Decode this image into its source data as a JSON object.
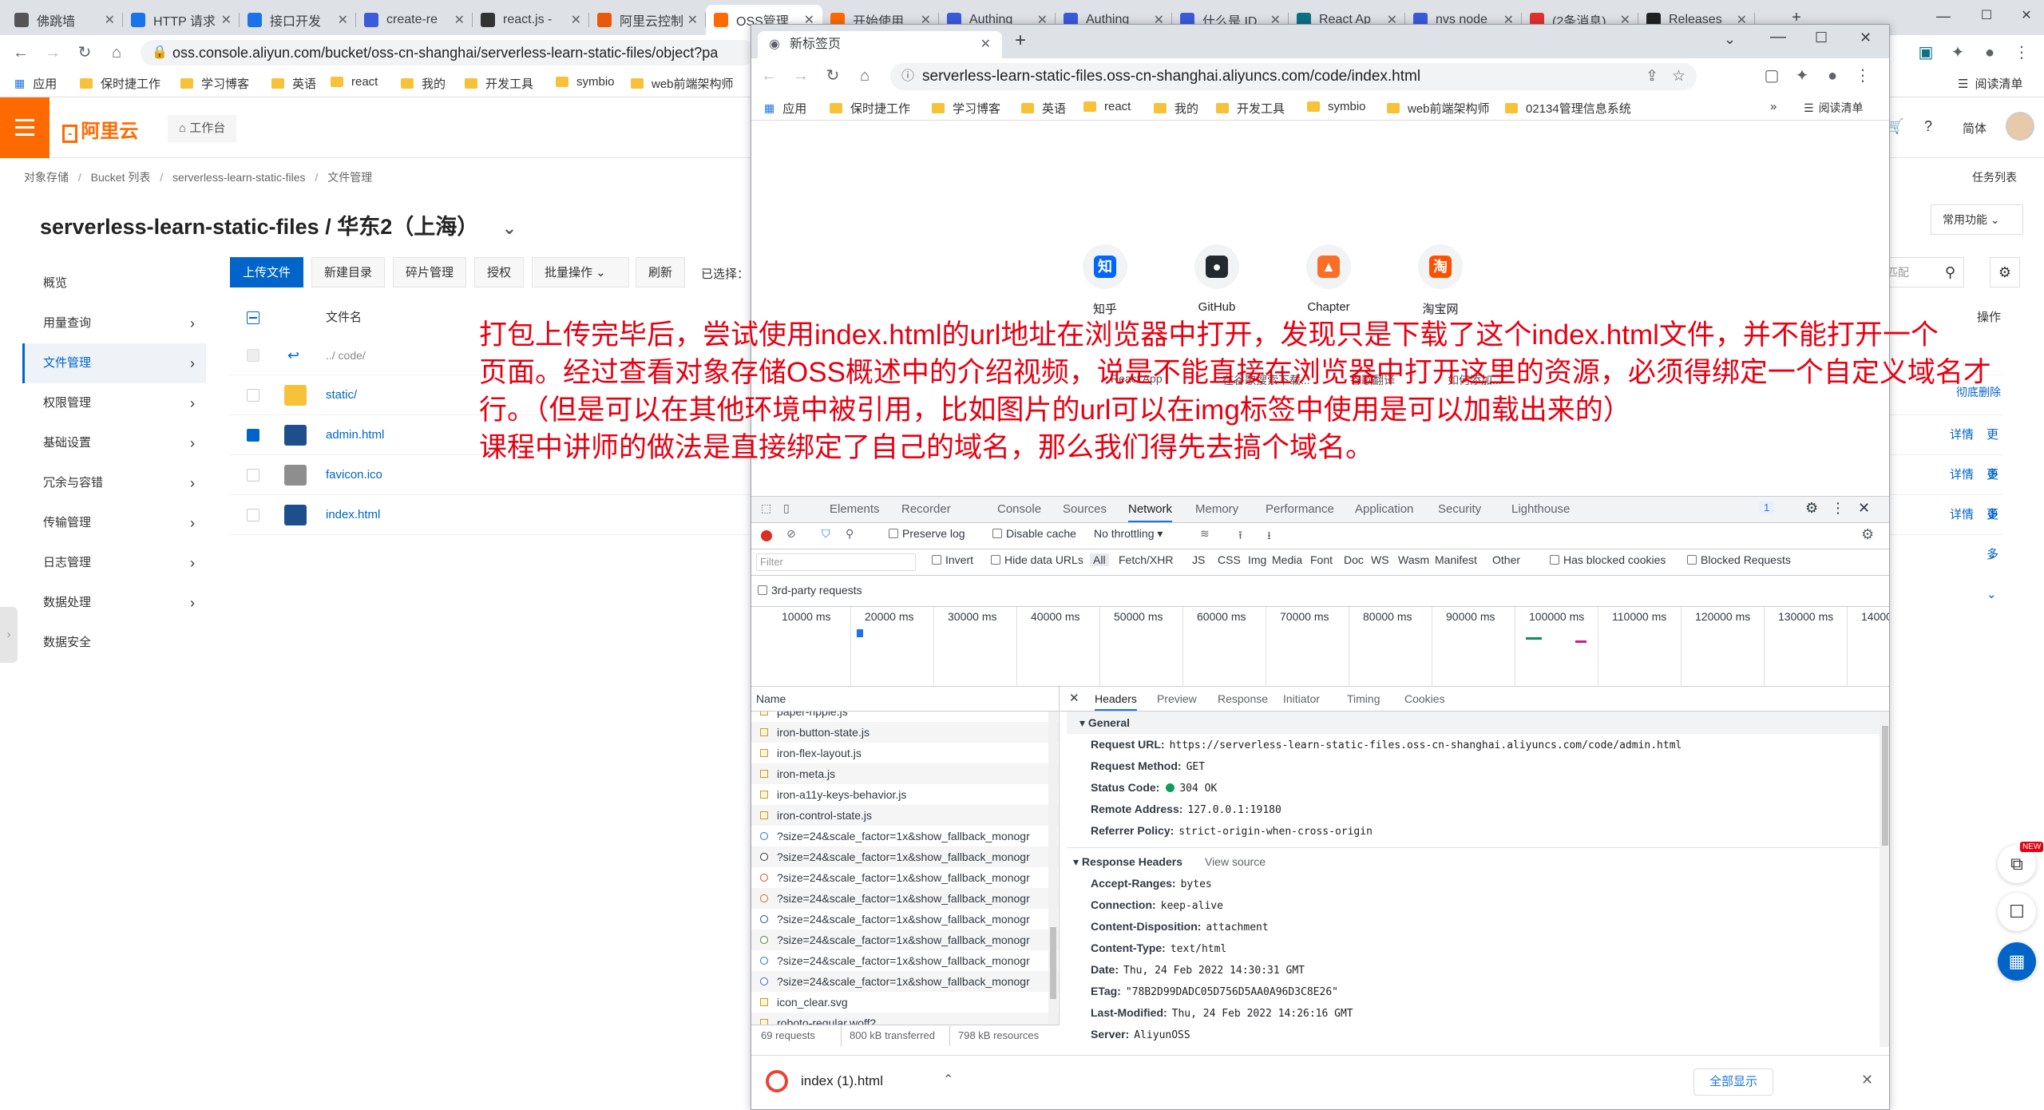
{
  "outer_tabs": [
    {
      "label": "佛跳墙",
      "color": "#555"
    },
    {
      "label": "HTTP 请求",
      "color": "#1a73e8"
    },
    {
      "label": "接口开发",
      "color": "#1a73e8"
    },
    {
      "label": "create-re",
      "color": "#3b5bdb"
    },
    {
      "label": "react.js -",
      "color": "#333"
    },
    {
      "label": "阿里云控制",
      "color": "#e8590c"
    },
    {
      "label": "OSS管理",
      "color": "#ff6a00"
    },
    {
      "label": "开始使用",
      "color": "#ff6a00"
    },
    {
      "label": "Authing",
      "color": "#3b5bdb"
    },
    {
      "label": "Authing",
      "color": "#3b5bdb"
    },
    {
      "label": "什么是 ID",
      "color": "#3b5bdb"
    },
    {
      "label": "React Ap",
      "color": "#0b7285"
    },
    {
      "label": "nvs node",
      "color": "#3b5bdb"
    },
    {
      "label": "(2条消息)",
      "color": "#e03131"
    },
    {
      "label": "Releases",
      "color": "#222"
    }
  ],
  "outer_url": "oss.console.aliyun.com/bucket/oss-cn-shanghai/serverless-learn-static-files/object?pa",
  "outer_bookmarks": [
    "应用",
    "保时捷工作",
    "学习博客",
    "英语",
    "react",
    "我的",
    "开发工具",
    "symbio",
    "web前端架构师"
  ],
  "outer_reading_list": "阅读清单",
  "console": {
    "logo": "阿里云",
    "workbench": "工作台",
    "lang": "简体",
    "task_list": "任务列表",
    "common_functions": "常用功能",
    "breadcrumb": [
      "对象存储",
      "Bucket 列表",
      "serverless-learn-static-files",
      "文件管理"
    ],
    "bucket_title": "serverless-learn-static-files / 华东2（上海）",
    "nav": [
      {
        "label": "概览",
        "chev": false
      },
      {
        "label": "用量查询",
        "chev": true
      },
      {
        "label": "文件管理",
        "chev": true
      },
      {
        "label": "权限管理",
        "chev": true
      },
      {
        "label": "基础设置",
        "chev": true
      },
      {
        "label": "冗余与容错",
        "chev": true
      },
      {
        "label": "传输管理",
        "chev": true
      },
      {
        "label": "日志管理",
        "chev": true
      },
      {
        "label": "数据处理",
        "chev": true
      },
      {
        "label": "数据安全",
        "chev": false
      }
    ],
    "toolbar": {
      "upload": "上传文件",
      "new_dir": "新建目录",
      "fragments": "碎片管理",
      "authorize": "授权",
      "batch": "批量操作",
      "refresh": "刷新",
      "selected": "已选择：",
      "search_placeholder": "匹配",
      "delete_all": "彻底删除"
    },
    "table": {
      "col_name": "文件名",
      "col_action": "操作",
      "back": "../ code/",
      "files": [
        {
          "name": "static/",
          "type": "folder",
          "checked": false,
          "detail": "",
          "more": ""
        },
        {
          "name": "admin.html",
          "type": "html",
          "checked": true,
          "detail": "详情",
          "more": "更多"
        },
        {
          "name": "favicon.ico",
          "type": "ico",
          "checked": false,
          "detail": "详情",
          "more": "更多"
        },
        {
          "name": "index.html",
          "type": "html",
          "checked": false,
          "detail": "详情",
          "more": "更多"
        }
      ]
    }
  },
  "annotation": [
    "打包上传完毕后，尝试使用index.html的url地址在浏览器中打开，发现只是下载了这个index.html文件，并不能打开一个",
    "页面。经过查看对象存储OSS概述中的介绍视频，说是不能直接在浏览器中打开这里的资源，必须得绑定一个自定义域名才",
    "行。（但是可以在其他环境中被引用，比如图片的url可以在img标签中使用是可以加载出来的）",
    "课程中讲师的做法是直接绑定了自己的域名，那么我们得先去搞个域名。"
  ],
  "popup": {
    "tab_title": "新标签页",
    "url": "serverless-learn-static-files.oss-cn-shanghai.aliyuncs.com/code/index.html",
    "bookmarks": [
      "应用",
      "保时捷工作",
      "学习博客",
      "英语",
      "react",
      "我的",
      "开发工具",
      "symbio",
      "web前端架构师",
      "02134管理信息系统"
    ],
    "reading_list": "阅读清单",
    "shortcuts": [
      {
        "label": "知乎",
        "glyph": "知",
        "color": "#0066ff"
      },
      {
        "label": "GitHub",
        "glyph": "●",
        "color": "#24292f"
      },
      {
        "label": "Chapter",
        "glyph": "▲",
        "color": "#fc6d26"
      },
      {
        "label": "淘宝网",
        "glyph": "淘",
        "color": "#ff5000"
      }
    ],
    "shortcuts_row2_partial": [
      "React App",
      "在谷歌搜索下载...",
      "谷歌翻译",
      "如何添加..."
    ],
    "devtools": {
      "tabs": [
        "Elements",
        "Recorder",
        "Console",
        "Sources",
        "Network",
        "Memory",
        "Performance",
        "Application",
        "Security",
        "Lighthouse"
      ],
      "active_tab": "Network",
      "issues_badge": "1",
      "preserve_log": "Preserve log",
      "disable_cache": "Disable cache",
      "throttling": "No throttling",
      "filter_placeholder": "Filter",
      "invert": "Invert",
      "hide_data_urls": "Hide data URLs",
      "types": [
        "All",
        "Fetch/XHR",
        "JS",
        "CSS",
        "Img",
        "Media",
        "Font",
        "Doc",
        "WS",
        "Wasm",
        "Manifest",
        "Other"
      ],
      "has_blocked": "Has blocked cookies",
      "blocked_requests": "Blocked Requests",
      "third_party": "3rd-party requests",
      "timeline_ticks": [
        "10000 ms",
        "20000 ms",
        "30000 ms",
        "40000 ms",
        "50000 ms",
        "60000 ms",
        "70000 ms",
        "80000 ms",
        "90000 ms",
        "100000 ms",
        "110000 ms",
        "120000 ms",
        "130000 ms",
        "14000"
      ],
      "name_col": "Name",
      "requests": [
        "paper-ripple.js",
        "iron-button-state.js",
        "iron-flex-layout.js",
        "iron-meta.js",
        "iron-a11y-keys-behavior.js",
        "iron-control-state.js",
        "?size=24&scale_factor=1x&show_fallback_monogr",
        "?size=24&scale_factor=1x&show_fallback_monogr",
        "?size=24&scale_factor=1x&show_fallback_monogr",
        "?size=24&scale_factor=1x&show_fallback_monogr",
        "?size=24&scale_factor=1x&show_fallback_monogr",
        "?size=24&scale_factor=1x&show_fallback_monogr",
        "?size=24&scale_factor=1x&show_fallback_monogr",
        "?size=24&scale_factor=1x&show_fallback_monogr",
        "icon_clear.svg",
        "roboto-regular.woff2"
      ],
      "summary": {
        "requests": "69 requests",
        "transferred": "800 kB transferred",
        "resources": "798 kB resources"
      },
      "detail_tabs": [
        "Headers",
        "Preview",
        "Response",
        "Initiator",
        "Timing",
        "Cookies"
      ],
      "general_title": "General",
      "general": [
        {
          "k": "Request URL:",
          "v": "https://serverless-learn-static-files.oss-cn-shanghai.aliyuncs.com/code/admin.html"
        },
        {
          "k": "Request Method:",
          "v": "GET"
        },
        {
          "k": "Status Code:",
          "v": "304 OK"
        },
        {
          "k": "Remote Address:",
          "v": "127.0.0.1:19180"
        },
        {
          "k": "Referrer Policy:",
          "v": "strict-origin-when-cross-origin"
        }
      ],
      "response_title": "Response Headers",
      "view_source": "View source",
      "response": [
        {
          "k": "Accept-Ranges:",
          "v": "bytes"
        },
        {
          "k": "Connection:",
          "v": "keep-alive"
        },
        {
          "k": "Content-Disposition:",
          "v": "attachment"
        },
        {
          "k": "Content-Type:",
          "v": "text/html"
        },
        {
          "k": "Date:",
          "v": "Thu, 24 Feb 2022 14:30:31 GMT"
        },
        {
          "k": "ETag:",
          "v": "\"78B2D99DADC05D756D5AA0A96D3C8E26\""
        },
        {
          "k": "Last-Modified:",
          "v": "Thu, 24 Feb 2022 14:26:16 GMT"
        },
        {
          "k": "Server:",
          "v": "AliyunOSS"
        }
      ]
    },
    "download": {
      "file": "index (1).html",
      "show_all": "全部显示"
    }
  },
  "float_new_badge": "NEW"
}
